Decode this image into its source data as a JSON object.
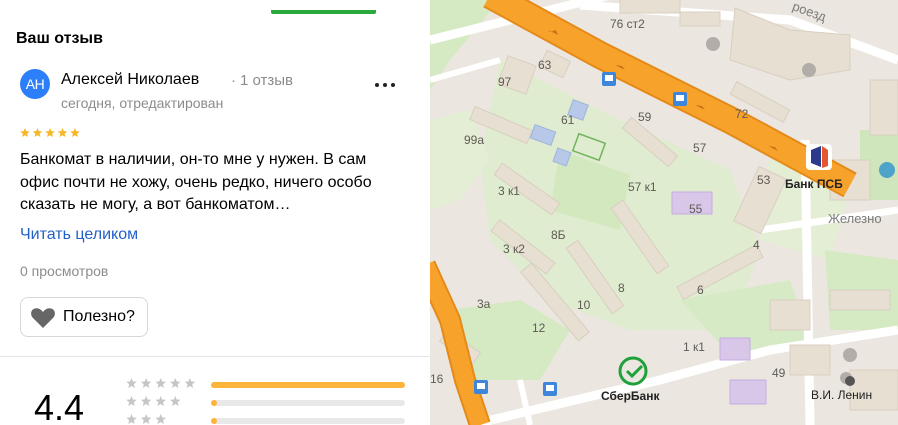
{
  "panel": {
    "section_title": "Ваш отзыв",
    "review": {
      "avatar_initials": "АН",
      "author": "Алексей Николаев",
      "review_count": "1 отзыв",
      "date": "сегодня, отредактирован",
      "rating": 5,
      "text": "Банкомат в наличии, он-то мне у нужен. В сам офис почти не хожу, очень редко, ничего особо сказать не могу, а вот банкоматом…",
      "read_more": "Читать целиком",
      "views": "0 просмотров",
      "helpful_label": "Полезно?"
    },
    "summary": {
      "rating": "4.4",
      "distribution": [
        {
          "stars": 5,
          "fraction": 1.0
        },
        {
          "stars": 4,
          "fraction": 0.03
        },
        {
          "stars": 3,
          "fraction": 0.03
        }
      ]
    }
  },
  "map": {
    "labels": {
      "b76": "76 ст2",
      "proezd": "роезд",
      "b63": "63",
      "b97": "97",
      "b61": "61",
      "b59": "59",
      "b72": "72",
      "b99a": "99а",
      "b57": "57",
      "b57k1": "57 к1",
      "b53": "53",
      "b3k1": "3 к1",
      "b55": "55",
      "b8b": "8Б",
      "b3k2": "3 к2",
      "b4": "4",
      "b3a": "3а",
      "b10": "10",
      "b8": "8",
      "b6": "6",
      "b12": "12",
      "b1k1": "1 к1",
      "b49": "49",
      "b16": "16",
      "street": "Железно",
      "bank_psb": "Банк ПСБ",
      "sberbank": "СберБанк",
      "lenin": "В.И. Ленин"
    },
    "colors": {
      "road_main": "#f7a32b",
      "road_edge": "#e48a1a",
      "park": "#d5e9c3",
      "block": "#f0ebe3",
      "building": "#e3dcd0",
      "school": "#b7c8e8",
      "clinic": "#d9c7ea",
      "sber_green": "#1fa03a",
      "psb_blue": "#2b3a8a"
    }
  }
}
